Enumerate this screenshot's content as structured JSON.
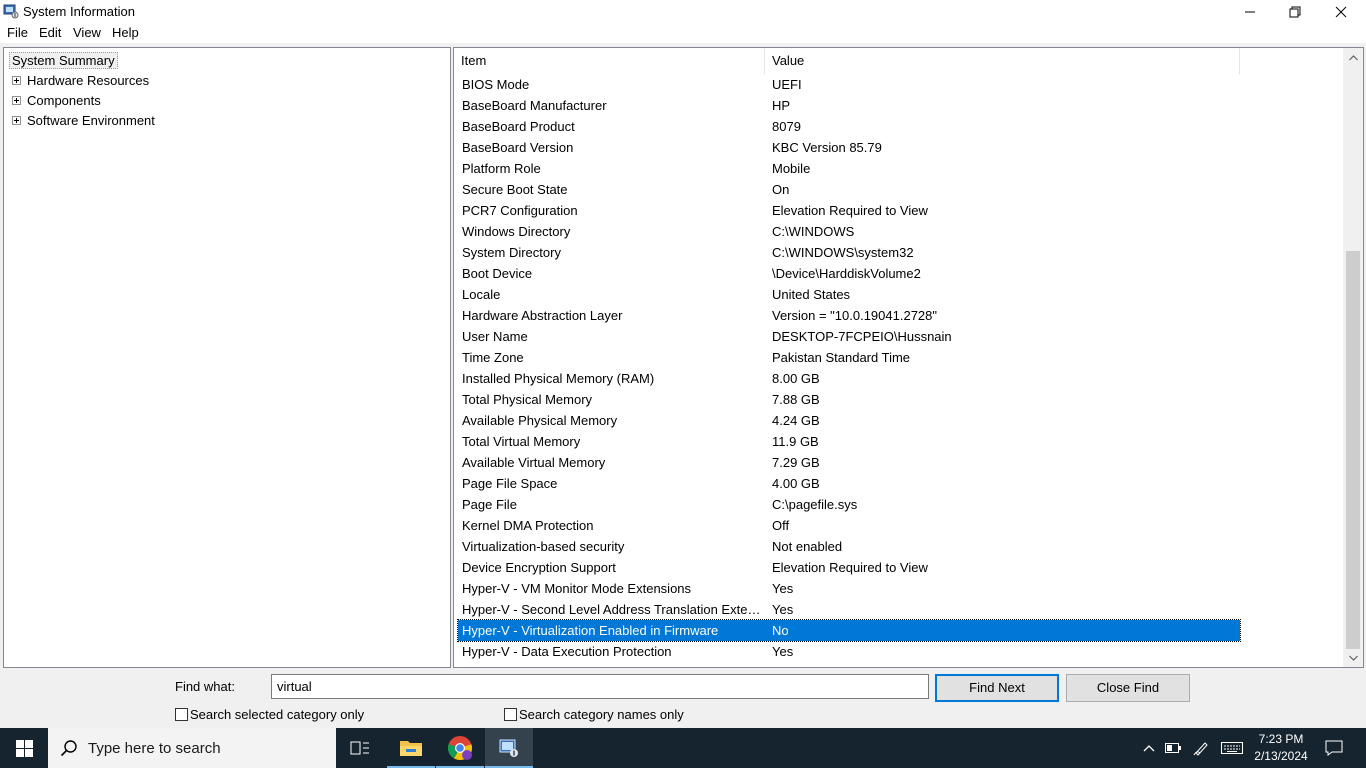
{
  "window": {
    "title": "System Information",
    "app_icon": "system-information-icon"
  },
  "menu": [
    "File",
    "Edit",
    "View",
    "Help"
  ],
  "tree": {
    "root": "System Summary",
    "children": [
      "Hardware Resources",
      "Components",
      "Software Environment"
    ]
  },
  "list": {
    "columns": [
      "Item",
      "Value"
    ],
    "rows": [
      [
        "BIOS Mode",
        "UEFI"
      ],
      [
        "BaseBoard Manufacturer",
        "HP"
      ],
      [
        "BaseBoard Product",
        "8079"
      ],
      [
        "BaseBoard Version",
        "KBC Version 85.79"
      ],
      [
        "Platform Role",
        "Mobile"
      ],
      [
        "Secure Boot State",
        "On"
      ],
      [
        "PCR7 Configuration",
        "Elevation Required to View"
      ],
      [
        "Windows Directory",
        "C:\\WINDOWS"
      ],
      [
        "System Directory",
        "C:\\WINDOWS\\system32"
      ],
      [
        "Boot Device",
        "\\Device\\HarddiskVolume2"
      ],
      [
        "Locale",
        "United States"
      ],
      [
        "Hardware Abstraction Layer",
        "Version = \"10.0.19041.2728\""
      ],
      [
        "User Name",
        "DESKTOP-7FCPEIO\\Hussnain"
      ],
      [
        "Time Zone",
        "Pakistan Standard Time"
      ],
      [
        "Installed Physical Memory (RAM)",
        "8.00 GB"
      ],
      [
        "Total Physical Memory",
        "7.88 GB"
      ],
      [
        "Available Physical Memory",
        "4.24 GB"
      ],
      [
        "Total Virtual Memory",
        "11.9 GB"
      ],
      [
        "Available Virtual Memory",
        "7.29 GB"
      ],
      [
        "Page File Space",
        "4.00 GB"
      ],
      [
        "Page File",
        "C:\\pagefile.sys"
      ],
      [
        "Kernel DMA Protection",
        "Off"
      ],
      [
        "Virtualization-based security",
        "Not enabled"
      ],
      [
        "Device Encryption Support",
        "Elevation Required to View"
      ],
      [
        "Hyper-V - VM Monitor Mode Extensions",
        "Yes"
      ],
      [
        "Hyper-V - Second Level Address Translation Exten...",
        "Yes"
      ],
      [
        "Hyper-V - Virtualization Enabled in Firmware",
        "No"
      ],
      [
        "Hyper-V - Data Execution Protection",
        "Yes"
      ]
    ],
    "selected_row": "Hyper-V - Virtualization Enabled in Firmware"
  },
  "find": {
    "label": "Find what:",
    "value": "virtual",
    "find_next": "Find Next",
    "close_find": "Close Find",
    "check_selected": "Search selected category only",
    "check_names": "Search category names only"
  },
  "taskbar": {
    "search_placeholder": "Type here to search",
    "time": "7:23 PM",
    "date": "2/13/2024",
    "accent": "#0078d7"
  }
}
